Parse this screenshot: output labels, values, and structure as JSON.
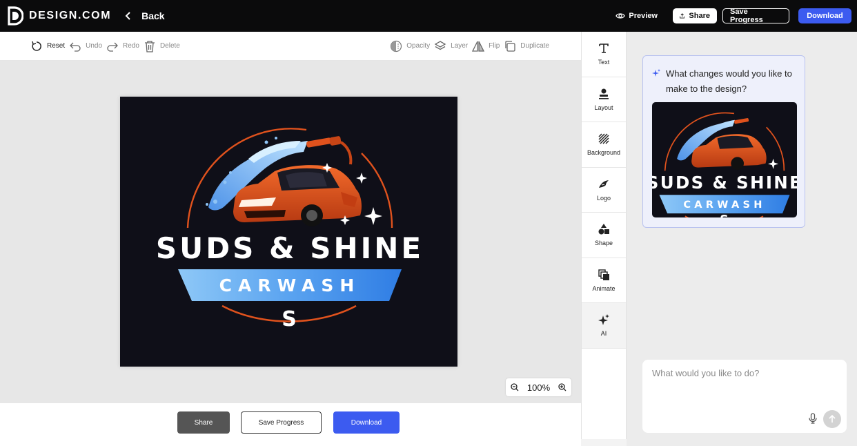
{
  "header": {
    "brand": "DESIGN.COM",
    "back_label": "Back",
    "preview_label": "Preview",
    "share_label": "Share",
    "save_label": "Save Progress",
    "download_label": "Download"
  },
  "toolbar": {
    "reset": "Reset",
    "undo": "Undo",
    "redo": "Redo",
    "delete": "Delete",
    "opacity": "Opacity",
    "layer": "Layer",
    "flip": "Flip",
    "duplicate": "Duplicate"
  },
  "logo": {
    "title": "SUDS & SHINE",
    "banner": "CARWASH",
    "initial": "S"
  },
  "zoom": {
    "level": "100%"
  },
  "bottom": {
    "share_label": "Share",
    "save_label": "Save Progress",
    "download_label": "Download"
  },
  "sidetools": [
    {
      "label": "Text",
      "icon": "text-icon"
    },
    {
      "label": "Layout",
      "icon": "layout-icon"
    },
    {
      "label": "Background",
      "icon": "background-icon"
    },
    {
      "label": "Logo",
      "icon": "logo-icon"
    },
    {
      "label": "Shape",
      "icon": "shape-icon"
    },
    {
      "label": "Animate",
      "icon": "animate-icon"
    },
    {
      "label": "AI",
      "icon": "ai-sparkle-icon"
    }
  ],
  "ai": {
    "question": "What changes would you like to make to the design?",
    "input_placeholder": "What would you like to do?"
  },
  "colors": {
    "accent": "#3c5bf0",
    "topbar": "#0b0b0c",
    "artboard": "#0f0f18",
    "car": "#e0521d",
    "banner": "#5aa3f0"
  }
}
